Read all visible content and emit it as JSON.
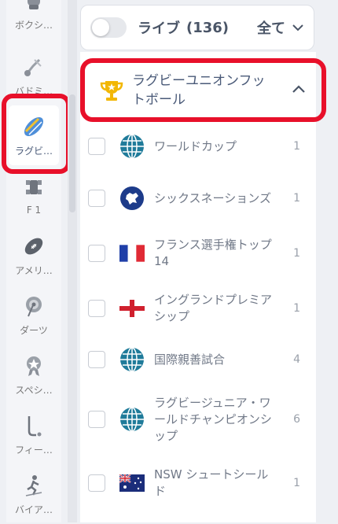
{
  "sidebar": {
    "items": [
      {
        "label": "ボクシ…",
        "icon": "boxing-glove-icon"
      },
      {
        "label": "バドミ…",
        "icon": "shuttlecock-icon"
      },
      {
        "label": "ラグビ…",
        "icon": "rugby-ball-icon",
        "active": true
      },
      {
        "label": "F 1",
        "icon": "formula1-car-icon"
      },
      {
        "label": "アメリ…",
        "icon": "american-football-icon"
      },
      {
        "label": "ダーツ",
        "icon": "dart-icon"
      },
      {
        "label": "スペシ…",
        "icon": "award-medal-icon"
      },
      {
        "label": "フィー…",
        "icon": "hockey-stick-icon"
      },
      {
        "label": "バイア…",
        "icon": "biathlon-skier-icon"
      }
    ]
  },
  "live": {
    "label": "ライブ",
    "count": "(136)",
    "filter": "全て",
    "toggle_on": false
  },
  "category": {
    "title": "ラグビーユニオンフットボール",
    "icon": "trophy-icon",
    "expanded": true
  },
  "competitions": [
    {
      "name": "ワールドカップ",
      "count": "1",
      "flag": "globe-icon"
    },
    {
      "name": "シックスネーションズ",
      "count": "1",
      "flag": "europe-icon"
    },
    {
      "name": "フランス選手権トップ14",
      "count": "1",
      "flag": "france-flag-icon"
    },
    {
      "name": "イングランドプレミアシップ",
      "count": "1",
      "flag": "england-flag-icon"
    },
    {
      "name": "国際親善試合",
      "count": "4",
      "flag": "globe-icon"
    },
    {
      "name": "ラグビージュニア・ワールドチャンピオンシップ",
      "count": "6",
      "flag": "globe-icon"
    },
    {
      "name": "NSW シュートシールド",
      "count": "1",
      "flag": "australia-flag-icon"
    }
  ],
  "colors": {
    "highlight": "#e8102a",
    "accent": "#4a5a78",
    "trophy": "#f2b705"
  }
}
